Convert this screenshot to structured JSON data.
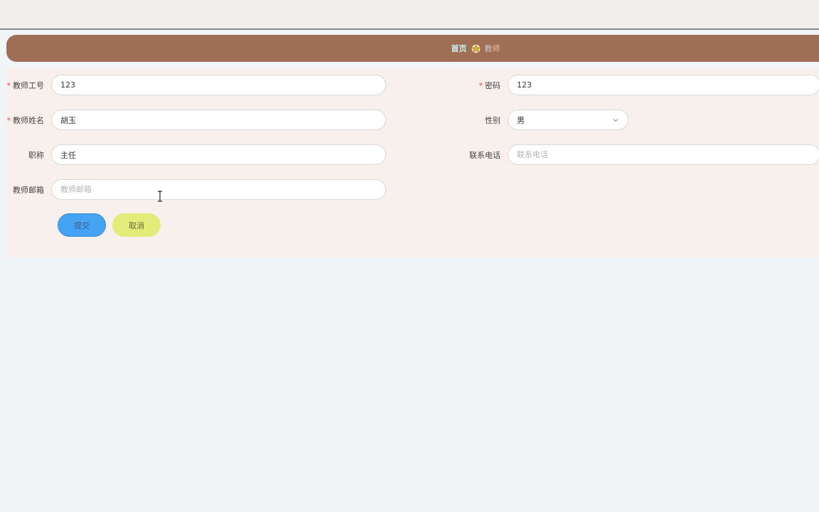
{
  "breadcrumb": {
    "home": "首页",
    "current": "教师"
  },
  "form": {
    "teacher_id": {
      "label": "教师工号",
      "required": "*",
      "value": "123"
    },
    "password": {
      "label": "密码",
      "required": "*",
      "value": "123"
    },
    "teacher_name": {
      "label": "教师姓名",
      "required": "*",
      "value": "胡玉"
    },
    "gender": {
      "label": "性别",
      "value": "男"
    },
    "title": {
      "label": "职称",
      "value": "主任"
    },
    "phone": {
      "label": "联系电话",
      "placeholder": "联系电话"
    },
    "email": {
      "label": "教师邮箱",
      "placeholder": "教师邮箱"
    }
  },
  "buttons": {
    "submit": "提交",
    "cancel": "取消"
  },
  "icons": {
    "breadcrumb_separator": "star-icon",
    "select": "chevron-down-icon",
    "cursor": "text-cursor-icon"
  },
  "colors": {
    "breadcrumb_bg": "#a06e54",
    "breadcrumb_home": "#c6f1f1",
    "submit_bg": "#46a3f4",
    "cancel_bg": "#e3ec78",
    "required": "#e84c4c"
  }
}
